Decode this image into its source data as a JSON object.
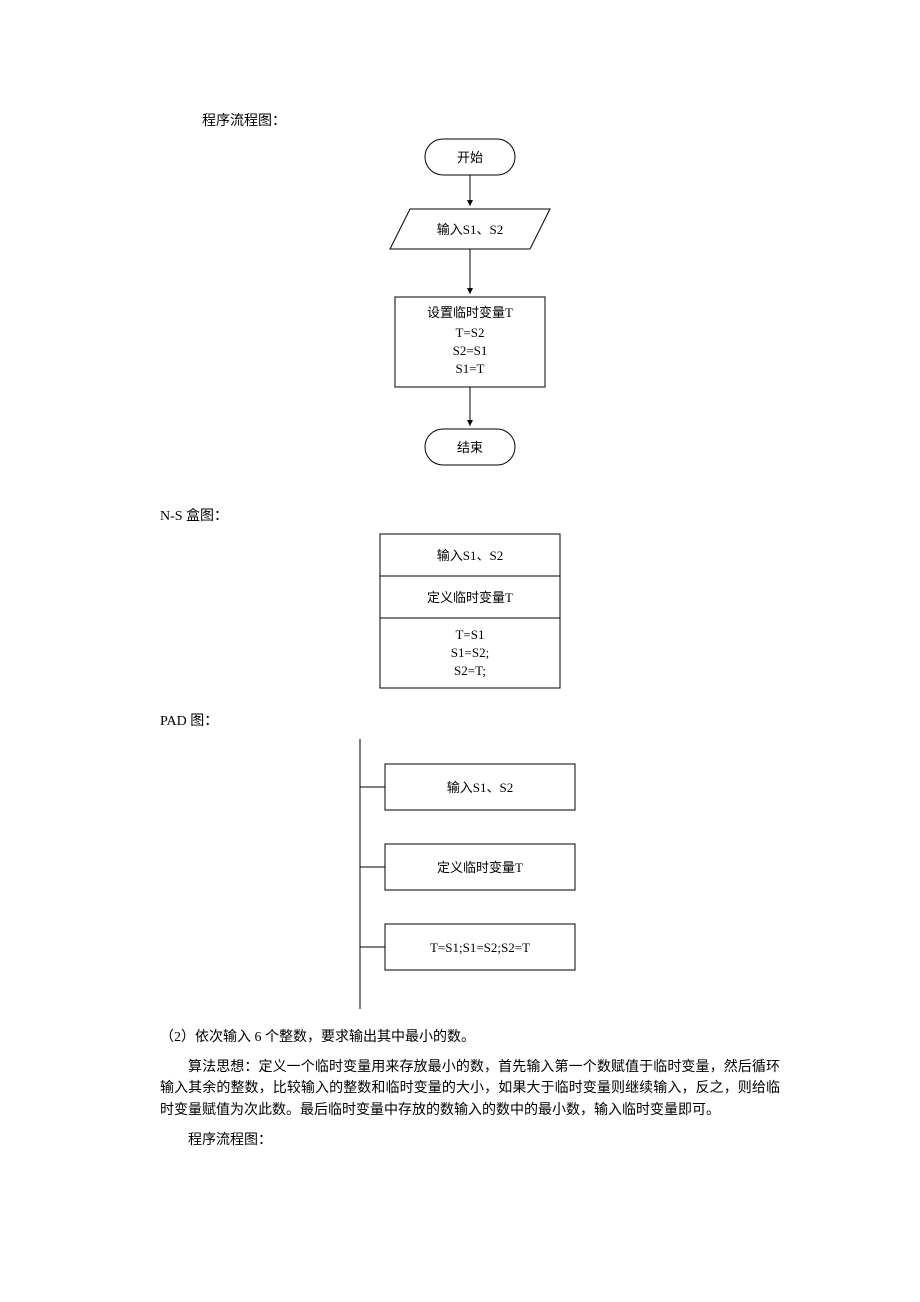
{
  "headings": {
    "flowchart": "程序流程图：",
    "nsbox": "N-S 盒图：",
    "pad": "PAD 图：",
    "flowchart2": "程序流程图："
  },
  "flowchart": {
    "start": "开始",
    "input": "输入S1、S2",
    "process_l1": "设置临时变量T",
    "process_l2": "T=S2",
    "process_l3": "S2=S1",
    "process_l4": "S1=T",
    "end": "结束"
  },
  "nsbox": {
    "row1": "输入S1、S2",
    "row2": "定义临时变量T",
    "row3_l1": "T=S1",
    "row3_l2": "S1=S2;",
    "row3_l3": "S2=T;"
  },
  "pad": {
    "row1": "输入S1、S2",
    "row2": "定义临时变量T",
    "row3": "T=S1;S1=S2;S2=T"
  },
  "q2": {
    "prompt": "（2）依次输入 6 个整数，要求输出其中最小的数。",
    "algo": "算法思想：定义一个临时变量用来存放最小的数，首先输入第一个数赋值于临时变量，然后循环输入其余的整数，比较输入的整数和临时变量的大小，如果大于临时变量则继续输入，反之，则给临时变量赋值为次此数。最后临时变量中存放的数输入的数中的最小数，输入临时变量即可。"
  }
}
